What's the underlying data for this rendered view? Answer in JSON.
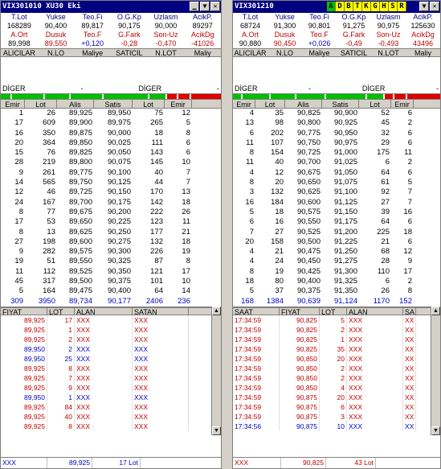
{
  "w1": {
    "title": "VIX301010    XU30 Eki",
    "stats_h1": [
      "T.Lot",
      "Yukse",
      "Teo.Fi",
      "O.G.Kp",
      "Uzlasm",
      "AcikP."
    ],
    "stats_v1": [
      "168289",
      "90,400",
      "89,817",
      "90,175",
      "90,000",
      "89297"
    ],
    "stats_h2": [
      "A.Ort",
      "Dusuk",
      "Teo.F",
      "G.Fark",
      "Son-Uz",
      "AcikDg"
    ],
    "stats_v2": [
      "89,998",
      "89,550",
      "+0,120",
      "-0,28",
      "-0,470",
      "-41026"
    ],
    "alici": [
      "ALICILAR",
      "N.LO",
      "Maliye",
      "SATICIL",
      "N.LOT",
      "Maliy"
    ],
    "diger": [
      "DİGER",
      "-",
      "DİGER",
      "-"
    ],
    "cols": [
      "Emir",
      "Lot",
      "Alis",
      "Satis",
      "Lot",
      "Emir"
    ],
    "rows": [
      [
        "1",
        "26",
        "89,925",
        "89,950",
        "75",
        "12"
      ],
      [
        "17",
        "609",
        "89,900",
        "89,975",
        "265",
        "5"
      ],
      [
        "16",
        "350",
        "89,875",
        "90,000",
        "18",
        "8"
      ],
      [
        "20",
        "364",
        "89,850",
        "90,025",
        "111",
        "6"
      ],
      [
        "15",
        "76",
        "89,825",
        "90,050",
        "143",
        "6"
      ],
      [
        "28",
        "219",
        "89,800",
        "90,075",
        "145",
        "10"
      ],
      [
        "9",
        "261",
        "89,775",
        "90,100",
        "40",
        "7"
      ],
      [
        "14",
        "565",
        "89,750",
        "90,125",
        "44",
        "7"
      ],
      [
        "12",
        "46",
        "89,725",
        "90,150",
        "170",
        "13"
      ],
      [
        "24",
        "167",
        "89,700",
        "90,175",
        "142",
        "18"
      ],
      [
        "8",
        "77",
        "89,675",
        "90,200",
        "222",
        "26"
      ],
      [
        "17",
        "53",
        "89,650",
        "90,225",
        "123",
        "11"
      ],
      [
        "8",
        "13",
        "89,625",
        "90,250",
        "177",
        "21"
      ],
      [
        "27",
        "198",
        "89,600",
        "90,275",
        "132",
        "18"
      ],
      [
        "9",
        "282",
        "89,575",
        "90,300",
        "226",
        "19"
      ],
      [
        "19",
        "51",
        "89,550",
        "90,325",
        "87",
        "8"
      ],
      [
        "11",
        "112",
        "89,525",
        "90,350",
        "121",
        "17"
      ],
      [
        "45",
        "317",
        "89,500",
        "90,375",
        "101",
        "10"
      ],
      [
        "5",
        "164",
        "89,475",
        "90,400",
        "64",
        "14"
      ]
    ],
    "total": [
      "309",
      "3950",
      "89,734",
      "90,177",
      "2406",
      "236"
    ],
    "tcols": [
      "FIYAT",
      "LOT",
      "ALAN",
      "SATAN"
    ],
    "trades": [
      [
        "89,925",
        "17",
        "XXX",
        "XXX",
        "red"
      ],
      [
        "89,925",
        "1",
        "XXX",
        "XXX",
        "red"
      ],
      [
        "89,925",
        "2",
        "XXX",
        "XXX",
        "red"
      ],
      [
        "89,950",
        "2",
        "XXX",
        "XXX",
        "blue"
      ],
      [
        "89,950",
        "25",
        "XXX",
        "XXX",
        "blue"
      ],
      [
        "89,925",
        "8",
        "XXX",
        "XXX",
        "red"
      ],
      [
        "89,925",
        "7",
        "XXX",
        "XXX",
        "red"
      ],
      [
        "89,925",
        "9",
        "XXX",
        "XXX",
        "red"
      ],
      [
        "89,950",
        "1",
        "XXX",
        "XXX",
        "blue"
      ],
      [
        "89,925",
        "84",
        "XXX",
        "XXX",
        "red"
      ],
      [
        "89,925",
        "40",
        "XXX",
        "XXX",
        "red"
      ],
      [
        "89,925",
        "8",
        "XXX",
        "XXX",
        "red"
      ]
    ],
    "foot": [
      "XXX",
      "89,925",
      "17 Lot"
    ]
  },
  "w2": {
    "title": "VIX301210",
    "letters": [
      "A",
      "D",
      "B",
      "T",
      "K",
      "G",
      "H",
      "S",
      "R"
    ],
    "stats_h1": [
      "T.Lot",
      "Yukse",
      "Teo.Fi",
      "O.G.Kp",
      "Uzlasm",
      "AcikP."
    ],
    "stats_v1": [
      "68724",
      "91,300",
      "90,801",
      "91,275",
      "90,975",
      "125630"
    ],
    "stats_h2": [
      "A.Ort",
      "Dusuk",
      "Teo.F",
      "G.Fark",
      "Son-Uz",
      "AcikDg"
    ],
    "stats_v2": [
      "90,880",
      "90,450",
      "+0,026",
      "-0,49",
      "-0,493",
      "43496"
    ],
    "alici": [
      "ALICILAR",
      "N.LO",
      "Maliye",
      "SATICIL",
      "N.LOT",
      "Maliy"
    ],
    "diger": [
      "DİGER",
      "-",
      "DİGER",
      "-"
    ],
    "cols": [
      "Emir",
      "Lot",
      "Alis",
      "Satis",
      "Lot",
      "Emir"
    ],
    "rows": [
      [
        "4",
        "35",
        "90,825",
        "90,900",
        "52",
        "6"
      ],
      [
        "13",
        "98",
        "90,800",
        "90,925",
        "45",
        "2"
      ],
      [
        "6",
        "202",
        "90,775",
        "90,950",
        "32",
        "6"
      ],
      [
        "11",
        "107",
        "90,750",
        "90,975",
        "29",
        "6"
      ],
      [
        "8",
        "154",
        "90,725",
        "91,000",
        "175",
        "11"
      ],
      [
        "11",
        "40",
        "90,700",
        "91,025",
        "6",
        "2"
      ],
      [
        "4",
        "12",
        "90,675",
        "91,050",
        "64",
        "6"
      ],
      [
        "8",
        "20",
        "90,650",
        "91,075",
        "61",
        "5"
      ],
      [
        "3",
        "132",
        "90,625",
        "91,100",
        "92",
        "7"
      ],
      [
        "16",
        "184",
        "90,600",
        "91,125",
        "27",
        "7"
      ],
      [
        "5",
        "18",
        "90,575",
        "91,150",
        "39",
        "16"
      ],
      [
        "6",
        "16",
        "90,550",
        "91,175",
        "64",
        "6"
      ],
      [
        "7",
        "27",
        "90,525",
        "91,200",
        "225",
        "18"
      ],
      [
        "20",
        "158",
        "90,500",
        "91,225",
        "21",
        "6"
      ],
      [
        "4",
        "21",
        "90,475",
        "91,250",
        "68",
        "12"
      ],
      [
        "4",
        "24",
        "90,450",
        "91,275",
        "28",
        "9"
      ],
      [
        "8",
        "19",
        "90,425",
        "91,300",
        "110",
        "17"
      ],
      [
        "18",
        "80",
        "90,400",
        "91,325",
        "6",
        "2"
      ],
      [
        "5",
        "37",
        "90,375",
        "91,350",
        "26",
        "8"
      ]
    ],
    "total": [
      "168",
      "1384",
      "90,639",
      "91,124",
      "1170",
      "152"
    ],
    "tcols": [
      "SAAT",
      "FIYAT",
      "LOT",
      "ALAN",
      "SA"
    ],
    "trades": [
      [
        "17:34:59",
        "90,825",
        "5",
        "XXX",
        "XX",
        "red"
      ],
      [
        "17:34:59",
        "90,825",
        "2",
        "XXX",
        "XX",
        "red"
      ],
      [
        "17:34:59",
        "90,825",
        "1",
        "XXX",
        "XX",
        "red"
      ],
      [
        "17:34:59",
        "90,825",
        "35",
        "XXX",
        "XX",
        "red"
      ],
      [
        "17:34:59",
        "90,850",
        "20",
        "XXX",
        "XX",
        "red"
      ],
      [
        "17:34:59",
        "90,850",
        "2",
        "XXX",
        "XX",
        "red"
      ],
      [
        "17:34:59",
        "90,850",
        "2",
        "XXX",
        "XX",
        "red"
      ],
      [
        "17:34:59",
        "90,850",
        "4",
        "XXX",
        "XX",
        "red"
      ],
      [
        "17:34:59",
        "90,875",
        "20",
        "XXX",
        "XX",
        "red"
      ],
      [
        "17:34:59",
        "90,875",
        "6",
        "XXX",
        "XX",
        "red"
      ],
      [
        "17:34:59",
        "90,875",
        "3",
        "XXX",
        "XX",
        "red"
      ],
      [
        "17:34:56",
        "90,875",
        "10",
        "XXX",
        "XX",
        "blue"
      ]
    ],
    "foot": [
      "XXX",
      "90,825",
      "43 Lot"
    ]
  }
}
